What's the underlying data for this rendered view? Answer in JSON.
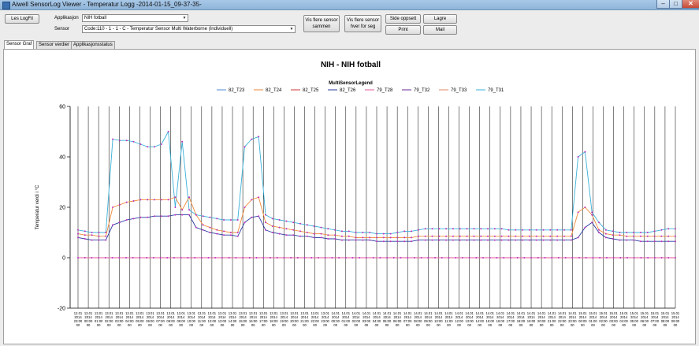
{
  "window": {
    "title": "Aiwell SensorLog Viewer - Temperatur Logg -2014-01-15_09-37-35-"
  },
  "toolbar": {
    "read_logfile": "Les LogFil",
    "app_label": "Applikasjon",
    "app_value": "NIH fotball",
    "sensor_label": "Sensor",
    "sensor_value": "Code:110 - 1 - 1 - C - Temperatur Sensor Multi Waterborne (Individuell)",
    "show_together": "Vis flere sensor sammen",
    "show_each": "Vis flere sensor hver for seg",
    "page_setup": "Side oppsett",
    "print": "Print",
    "save": "Lagre",
    "mail": "Mail"
  },
  "tabs": [
    "Sensor Graf",
    "Sensor verdier",
    "Applikasjonsstatus"
  ],
  "chart_data": {
    "type": "line",
    "title": "NIH - NIH fotball",
    "legend_title": "MultiSensorLegend",
    "legend_position": "top",
    "ylabel": "Temperatur verdi i °C",
    "ylim": [
      -20,
      60
    ],
    "yticks": [
      -20,
      0,
      20,
      40,
      60
    ],
    "grid": "vertical",
    "colors": {
      "82_T23": "#4a8ad8",
      "82_T24": "#f08a3a",
      "82_T25": "#d03a3a",
      "82_T26": "#2a3aa0",
      "79_T28": "#e05a9a",
      "79_T32": "#6a2a9a",
      "79_T33": "#e08a60",
      "79_T31": "#3ab0d8"
    },
    "x_dates": [
      "12.01",
      "13.01",
      "13.01",
      "13.01",
      "13.01",
      "13.01",
      "13.01",
      "13.01",
      "13.01",
      "13.01",
      "13.01",
      "13.01",
      "13.01",
      "13.01",
      "13.01",
      "13.01",
      "13.01",
      "13.01",
      "13.01",
      "13.01",
      "13.01",
      "13.01",
      "13.01",
      "13.01",
      "13.01",
      "14.01",
      "14.01",
      "14.01",
      "14.01",
      "14.01",
      "14.01",
      "14.01",
      "14.01",
      "14.01",
      "14.01",
      "14.01",
      "14.01",
      "14.01",
      "14.01",
      "14.01",
      "14.01",
      "14.01",
      "14.01",
      "14.01",
      "14.01",
      "14.01",
      "14.01",
      "14.01",
      "14.01",
      "15.01",
      "15.01",
      "15.01",
      "15.01",
      "15.01",
      "15.01",
      "15.01",
      "15.01",
      "15.01",
      "15.01"
    ],
    "x_years": "2014",
    "x_times": [
      "23:00",
      "00:00",
      "01:00",
      "02:00",
      "03:00",
      "04:00",
      "05:00",
      "06:00",
      "07:00",
      "08:00",
      "09:00",
      "10:00",
      "11:00",
      "12:00",
      "13:00",
      "14:00",
      "15:00",
      "16:00",
      "17:00",
      "18:00",
      "19:00",
      "20:00",
      "21:00",
      "22:00",
      "23:00",
      "00:00",
      "01:00",
      "02:00",
      "03:00",
      "04:00",
      "05:00",
      "06:00",
      "07:00",
      "08:00",
      "09:00",
      "10:00",
      "11:00",
      "12:00",
      "13:00",
      "14:00",
      "15:00",
      "16:00",
      "17:00",
      "18:00",
      "19:00",
      "20:00",
      "21:00",
      "22:00",
      "23:00",
      "00:00",
      "01:00",
      "02:00",
      "03:00",
      "04:00",
      "05:00",
      "06:00",
      "07:00",
      "08:00",
      "09:00"
    ],
    "series": [
      {
        "name": "79_T31",
        "values": [
          11,
          10.5,
          10,
          10,
          10,
          47,
          46.5,
          46.5,
          46,
          45,
          44,
          44,
          45,
          50,
          20,
          46,
          19,
          17,
          16.5,
          16,
          15.5,
          15,
          15,
          15,
          44,
          47,
          48,
          17,
          15.5,
          15,
          14.5,
          14,
          13.5,
          13,
          12.5,
          12,
          11.5,
          11,
          10.5,
          10.5,
          10,
          10,
          10,
          9.5,
          9.5,
          9.5,
          10,
          10.5,
          10.5,
          11,
          11.5,
          11.5,
          11.5,
          11.5,
          11.5,
          11.5,
          11.5,
          11.5,
          11.5,
          11.5,
          11.5,
          11.5,
          11,
          11,
          11,
          11,
          11,
          11,
          11,
          11,
          11,
          11,
          40,
          42,
          18,
          14,
          11,
          10.5,
          10,
          10,
          10,
          10,
          10,
          10.5,
          11,
          11.5,
          11.5
        ]
      },
      {
        "name": "82_T24",
        "values": [
          9.5,
          9,
          9,
          8.5,
          8.5,
          20,
          21,
          22,
          22.5,
          23,
          23,
          23,
          23,
          23,
          24,
          19,
          24,
          17,
          13,
          12,
          11,
          10.5,
          10,
          10,
          20,
          23,
          24,
          14,
          12.5,
          12,
          11.5,
          11,
          10.5,
          10,
          9.5,
          9.5,
          9,
          9,
          8.5,
          8.5,
          8,
          8,
          8,
          8,
          8,
          8,
          8,
          8,
          8,
          8.5,
          8.5,
          8.5,
          8.5,
          8.5,
          8.5,
          8.5,
          8.5,
          8.5,
          8.5,
          8.5,
          8.5,
          8.5,
          8.5,
          8.5,
          8.5,
          8.5,
          8.5,
          8.5,
          8.5,
          8.5,
          8.5,
          8.5,
          18,
          20,
          17,
          11,
          9.5,
          9,
          9,
          8.5,
          8.5,
          8.5,
          8.5,
          8.5,
          8.5,
          8.5,
          8.5
        ]
      },
      {
        "name": "82_T26",
        "values": [
          8,
          7.5,
          7,
          7,
          7,
          13,
          14,
          15,
          15.5,
          16,
          16,
          16.5,
          16.5,
          16.5,
          17,
          17,
          17,
          12,
          11,
          10,
          9.5,
          9,
          9,
          8.5,
          14,
          16,
          16.5,
          11,
          10,
          9.5,
          9,
          9,
          8.5,
          8.5,
          8,
          8,
          7.5,
          7.5,
          7,
          7,
          7,
          7,
          7,
          6.5,
          6.5,
          6.5,
          6.5,
          6.5,
          6.5,
          7,
          7,
          7,
          7,
          7,
          7,
          7,
          7,
          7,
          7,
          7,
          7,
          7,
          7,
          7,
          7,
          7,
          7,
          7,
          7,
          7,
          7,
          7,
          8,
          12,
          14,
          10,
          8,
          7.5,
          7,
          7,
          7,
          6.5,
          6.5,
          6.5,
          6.5,
          6.5,
          6.5
        ]
      },
      {
        "name": "79_T28",
        "values": [
          0,
          0,
          0,
          0,
          0,
          0,
          0,
          0,
          0,
          0,
          0,
          0,
          0,
          0,
          0,
          0,
          0,
          0,
          0,
          0,
          0,
          0,
          0,
          0,
          0,
          0,
          0,
          0,
          0,
          0,
          0,
          0,
          0,
          0,
          0,
          0,
          0,
          0,
          0,
          0,
          0,
          0,
          0,
          0,
          0,
          0,
          0,
          0,
          0,
          0,
          0,
          0,
          0,
          0,
          0,
          0,
          0,
          0,
          0,
          0,
          0,
          0,
          0,
          0,
          0,
          0,
          0,
          0,
          0,
          0,
          0,
          0,
          0,
          0,
          0,
          0,
          0,
          0,
          0,
          0,
          0,
          0,
          0,
          0,
          0,
          0,
          0,
          0
        ]
      }
    ]
  }
}
